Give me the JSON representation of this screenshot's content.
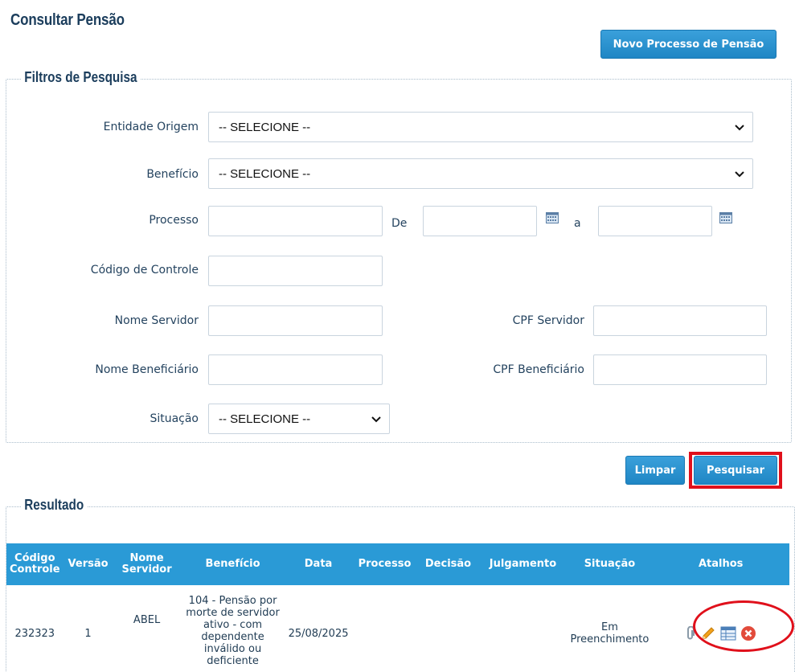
{
  "page": {
    "title": "Consultar Pensão",
    "new_button": "Novo Processo de Pensão"
  },
  "filters": {
    "legend": "Filtros de Pesquisa",
    "entidade_label": "Entidade Origem",
    "entidade_value": "-- SELECIONE --",
    "beneficio_label": "Benefício",
    "beneficio_value": "-- SELECIONE --",
    "processo_label": "Processo",
    "de_label": "De",
    "a_label": "a",
    "codigo_label": "Código de Controle",
    "nome_servidor_label": "Nome Servidor",
    "cpf_servidor_label": "CPF Servidor",
    "nome_beneficiario_label": "Nome Beneficiário",
    "cpf_beneficiario_label": "CPF Beneficiário",
    "situacao_label": "Situação",
    "situacao_value": "-- SELECIONE --",
    "clear_button": "Limpar",
    "search_button": "Pesquisar"
  },
  "results": {
    "legend": "Resultado",
    "columns": [
      "Código Controle",
      "Versão",
      "Nome Servidor",
      "Benefício",
      "Data",
      "Processo",
      "Decisão",
      "Julgamento",
      "Situação",
      "Atalhos"
    ],
    "rows": [
      {
        "codigo": "232323",
        "versao": "1",
        "nome_servidor": "ABEL",
        "beneficio": "104 - Pensão por morte de servidor ativo - com dependente inválido ou deficiente",
        "data": "25/08/2025",
        "processo": "",
        "decisao": "",
        "julgamento": "",
        "situacao": "Em Preenchimento",
        "icons": [
          "paperclip-icon",
          "pencil-icon",
          "table-icon",
          "delete-icon"
        ]
      }
    ]
  },
  "colors": {
    "accent": "#2a9ad6",
    "title": "#1b3d5c",
    "highlight": "#e0101b"
  }
}
